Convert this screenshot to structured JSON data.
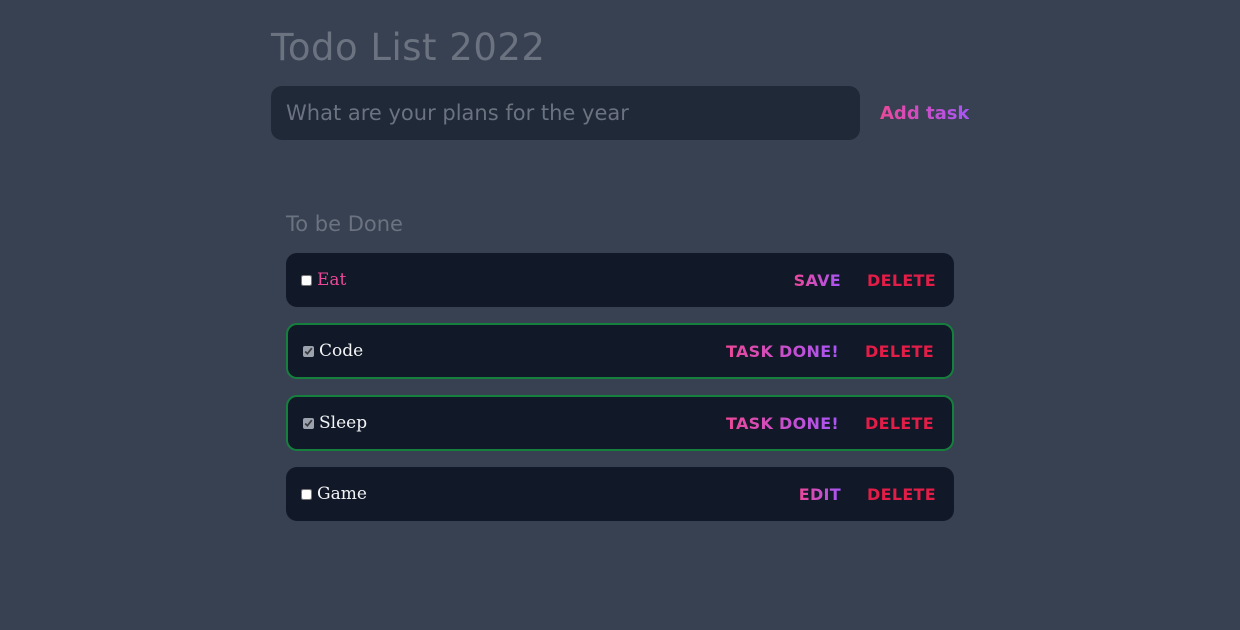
{
  "header": {
    "title": "Todo List 2022"
  },
  "new_task": {
    "placeholder": "What are your plans for the year",
    "value": "",
    "add_label": "Add task"
  },
  "list": {
    "heading": "To be Done",
    "tasks": [
      {
        "name": "Eat",
        "checked": false,
        "editing": true,
        "primary_action": "SAVE",
        "delete_label": "DELETE"
      },
      {
        "name": "Code",
        "checked": true,
        "editing": false,
        "primary_action": "TASK DONE!",
        "delete_label": "DELETE"
      },
      {
        "name": "Sleep",
        "checked": true,
        "editing": false,
        "primary_action": "TASK DONE!",
        "delete_label": "DELETE"
      },
      {
        "name": "Game",
        "checked": false,
        "editing": false,
        "primary_action": "EDIT",
        "delete_label": "DELETE"
      }
    ]
  },
  "colors": {
    "background": "#374151",
    "input_background": "#1f2937",
    "task_background": "#111827",
    "accent_gradient_start": "#ec4899",
    "accent_gradient_end": "#a855f7",
    "delete": "#e11d48",
    "done_border": "#15803d"
  }
}
